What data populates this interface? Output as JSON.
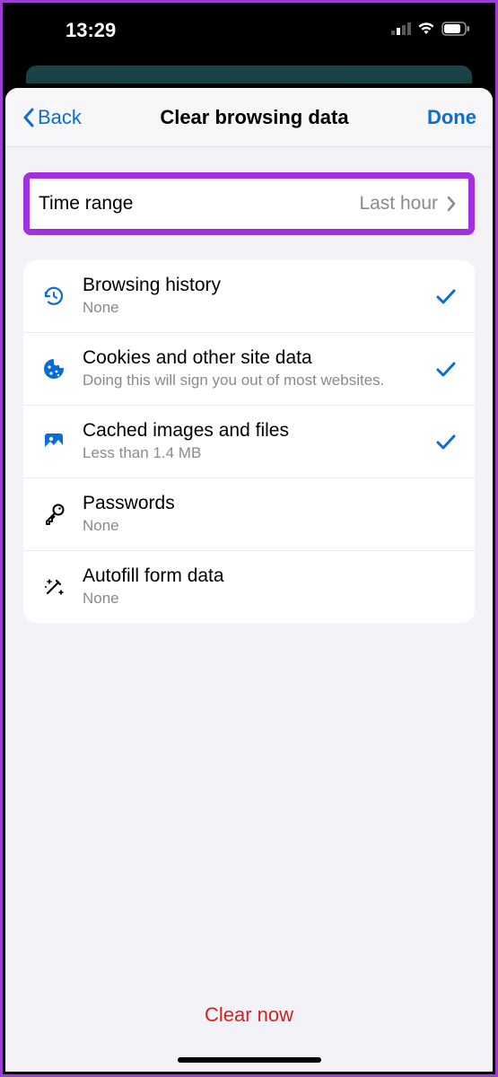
{
  "status_bar": {
    "time": "13:29"
  },
  "nav": {
    "back_label": "Back",
    "title": "Clear browsing data",
    "done_label": "Done"
  },
  "time_range": {
    "label": "Time range",
    "value": "Last hour"
  },
  "items": [
    {
      "title": "Browsing history",
      "subtitle": "None",
      "checked": true,
      "icon": "history"
    },
    {
      "title": "Cookies and other site data",
      "subtitle": "Doing this will sign you out of most websites.",
      "checked": true,
      "icon": "cookie"
    },
    {
      "title": "Cached images and files",
      "subtitle": "Less than 1.4 MB",
      "checked": true,
      "icon": "image"
    },
    {
      "title": "Passwords",
      "subtitle": "None",
      "checked": false,
      "icon": "key"
    },
    {
      "title": "Autofill form data",
      "subtitle": "None",
      "checked": false,
      "icon": "wand"
    }
  ],
  "footer": {
    "clear_now_label": "Clear now"
  }
}
